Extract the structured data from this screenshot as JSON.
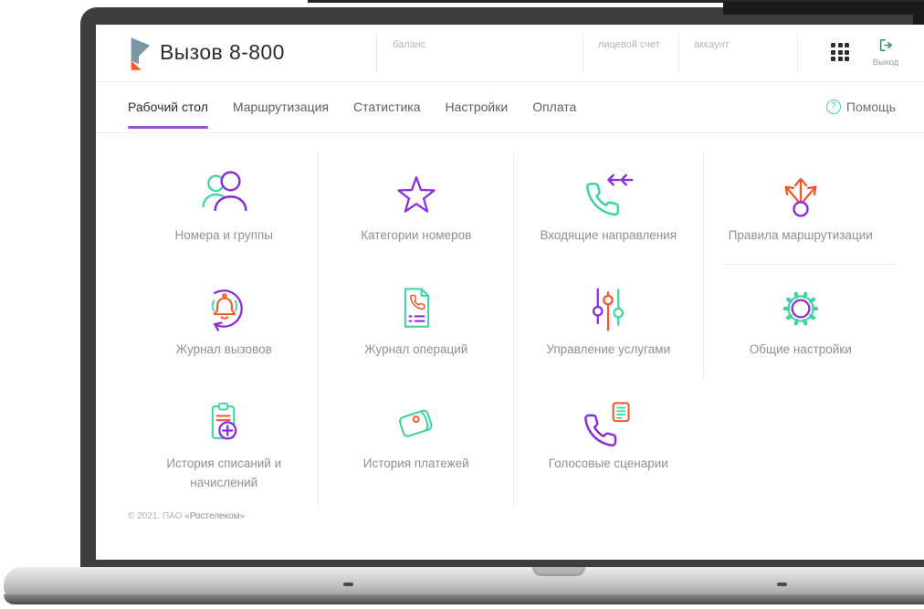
{
  "app": {
    "title": "Вызов 8-800",
    "logo_icon": "rostelecom-logo"
  },
  "header": {
    "balance_label": "баланс",
    "personal_account_label": "лицевой счет",
    "account_label": "аккаунт",
    "apps_icon": "apps-grid-icon",
    "exit_label": "Выход"
  },
  "nav": {
    "tabs": [
      {
        "label": "Рабочий стол",
        "active": true
      },
      {
        "label": "Маршрутизация",
        "active": false
      },
      {
        "label": "Статистика",
        "active": false
      },
      {
        "label": "Настройки",
        "active": false
      },
      {
        "label": "Оплата",
        "active": false
      }
    ],
    "help_label": "Помощь",
    "help_glyph": "?"
  },
  "tiles": [
    {
      "label": "Номера и группы",
      "icon": "users-icon"
    },
    {
      "label": "Категории номеров",
      "icon": "star-icon"
    },
    {
      "label": "Входящие направления",
      "icon": "incoming-calls-icon"
    },
    {
      "label": "Правила маршрутизации",
      "icon": "routing-arrows-icon"
    },
    {
      "label": "Журнал вызовов",
      "icon": "call-journal-icon"
    },
    {
      "label": "Журнал операций",
      "icon": "operations-journal-icon"
    },
    {
      "label": "Управление услугами",
      "icon": "sliders-icon"
    },
    {
      "label": "Общие настройки",
      "icon": "gear-icon"
    },
    {
      "label": "История списаний и начислений",
      "icon": "clipboard-plus-icon"
    },
    {
      "label": "История платежей",
      "icon": "wallet-icon"
    },
    {
      "label": "Голосовые сценарии",
      "icon": "voice-script-icon"
    }
  ],
  "footer": {
    "copyright_prefix": "© 2021. ПАО ",
    "copyright_org": "«Ростелеком»"
  },
  "colors": {
    "purple": "#8a2be2",
    "mint_green": "#3fd3a4",
    "orange": "#f2572b",
    "exit_teal": "#3a8577",
    "logo_slate": "#7e97a6",
    "logo_orange": "#ff5a26",
    "active_tab_underline": "#9c4fd9"
  }
}
